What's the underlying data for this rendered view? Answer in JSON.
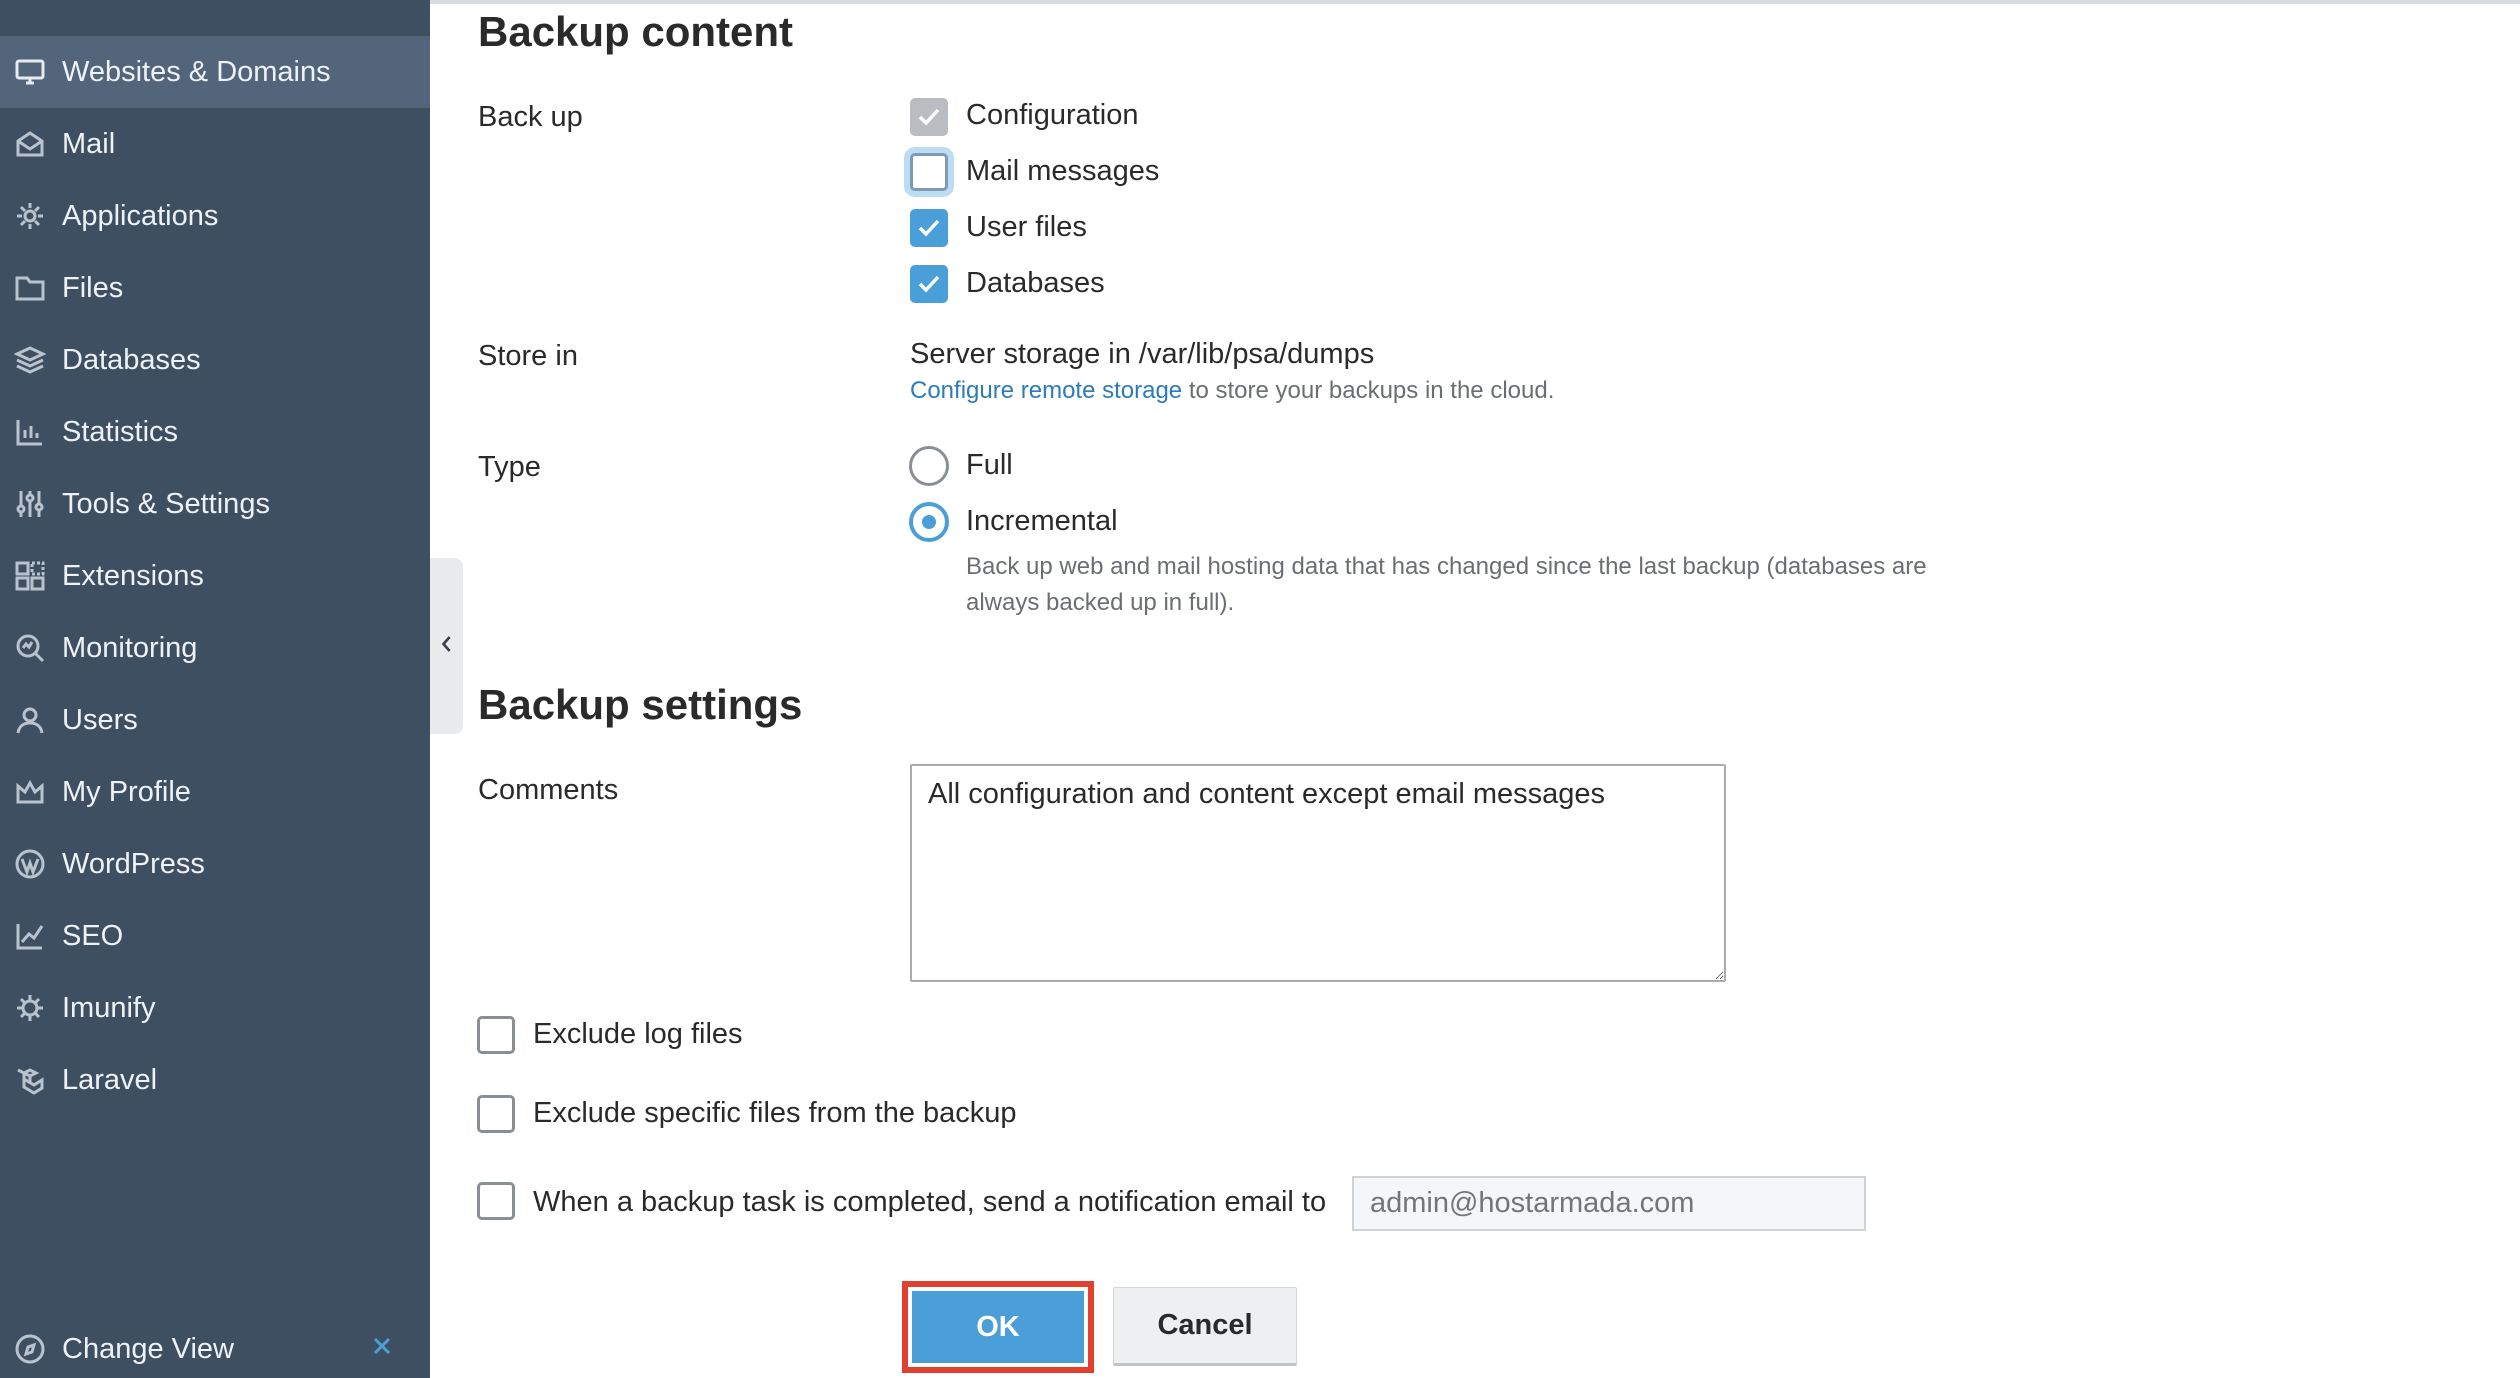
{
  "sidebar": {
    "items": [
      {
        "label": "Websites & Domains",
        "icon": "monitor-icon",
        "active": true
      },
      {
        "label": "Mail",
        "icon": "mail-icon"
      },
      {
        "label": "Applications",
        "icon": "gear-icon"
      },
      {
        "label": "Files",
        "icon": "folder-icon"
      },
      {
        "label": "Databases",
        "icon": "layers-icon"
      },
      {
        "label": "Statistics",
        "icon": "bar-chart-icon"
      },
      {
        "label": "Tools & Settings",
        "icon": "sliders-icon"
      },
      {
        "label": "Extensions",
        "icon": "extensions-icon"
      },
      {
        "label": "Monitoring",
        "icon": "monitoring-icon"
      },
      {
        "label": "Users",
        "icon": "user-icon"
      },
      {
        "label": "My Profile",
        "icon": "crown-icon"
      },
      {
        "label": "WordPress",
        "icon": "wordpress-icon"
      },
      {
        "label": "SEO",
        "icon": "seo-icon"
      },
      {
        "label": "Imunify",
        "icon": "imunify-icon"
      },
      {
        "label": "Laravel",
        "icon": "laravel-icon"
      }
    ],
    "change_view": {
      "label": "Change View",
      "icon": "compass-icon"
    }
  },
  "backup_content": {
    "title": "Backup content",
    "backup_label": "Back up",
    "options": [
      {
        "label": "Configuration",
        "checked": true,
        "disabled": true
      },
      {
        "label": "Mail messages",
        "checked": false,
        "focused": true
      },
      {
        "label": "User files",
        "checked": true
      },
      {
        "label": "Databases",
        "checked": true
      }
    ],
    "store_in": {
      "label": "Store in",
      "value": "Server storage in /var/lib/psa/dumps",
      "link_text": "Configure remote storage",
      "link_suffix": " to store your backups in the cloud."
    },
    "type": {
      "label": "Type",
      "options": [
        {
          "label": "Full",
          "selected": false
        },
        {
          "label": "Incremental",
          "selected": true
        }
      ],
      "hint_line1": "Back up web and mail hosting data that has changed since the last backup (databases are",
      "hint_line2": "always backed up in full)."
    }
  },
  "backup_settings": {
    "title": "Backup settings",
    "comments_label": "Comments",
    "comments_value": "All configuration and content except email messages",
    "exclude_logs_label": "Exclude log files",
    "exclude_specific_label": "Exclude specific files from the backup",
    "notify_label": "When a backup task is completed, send a notification email to",
    "notify_email_placeholder": "admin@hostarmada.com"
  },
  "buttons": {
    "ok": "OK",
    "cancel": "Cancel"
  },
  "colors": {
    "sidebar_bg": "#3f4f62",
    "accent": "#4a9fd8",
    "highlight": "#e2402f"
  }
}
